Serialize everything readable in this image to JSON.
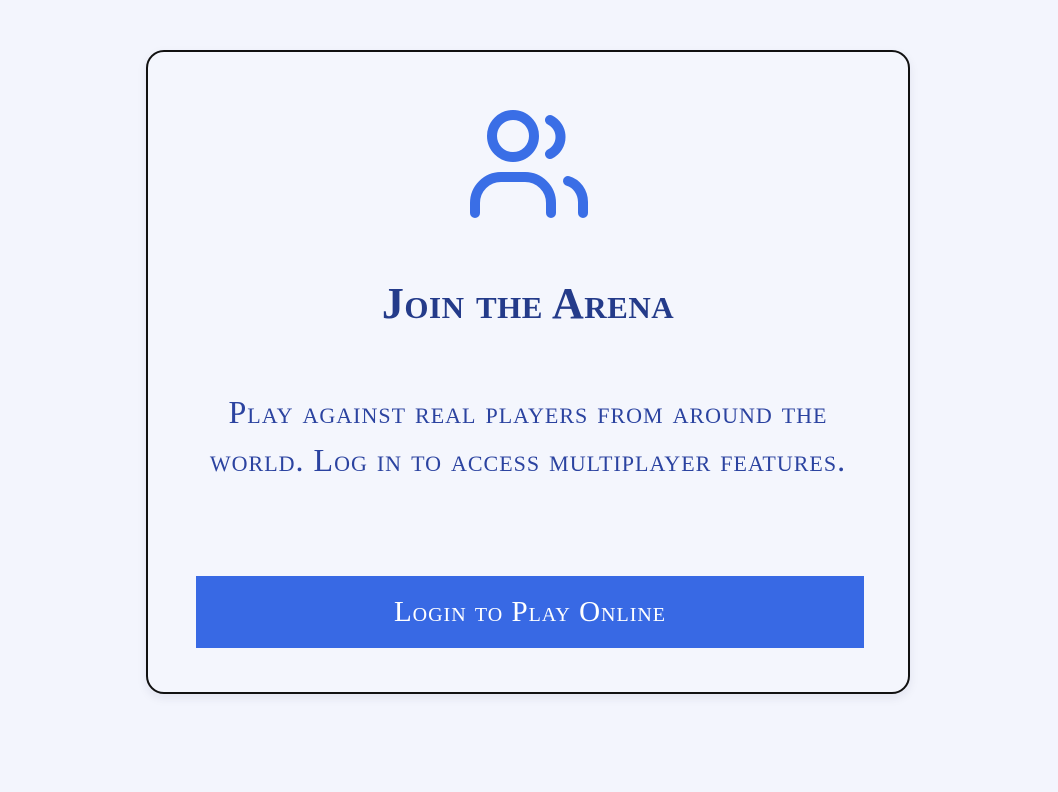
{
  "card": {
    "icon": "users-icon",
    "title": "Join the Arena",
    "description": "Play against real players from around the world. Log in to access multiplayer features.",
    "button_label": "Login to Play Online"
  },
  "colors": {
    "background": "#f3f5fd",
    "card_background": "#f4f6fd",
    "title": "#243b8a",
    "text": "#2b43a0",
    "accent": "#3869e4",
    "icon": "#3a6ee6"
  }
}
